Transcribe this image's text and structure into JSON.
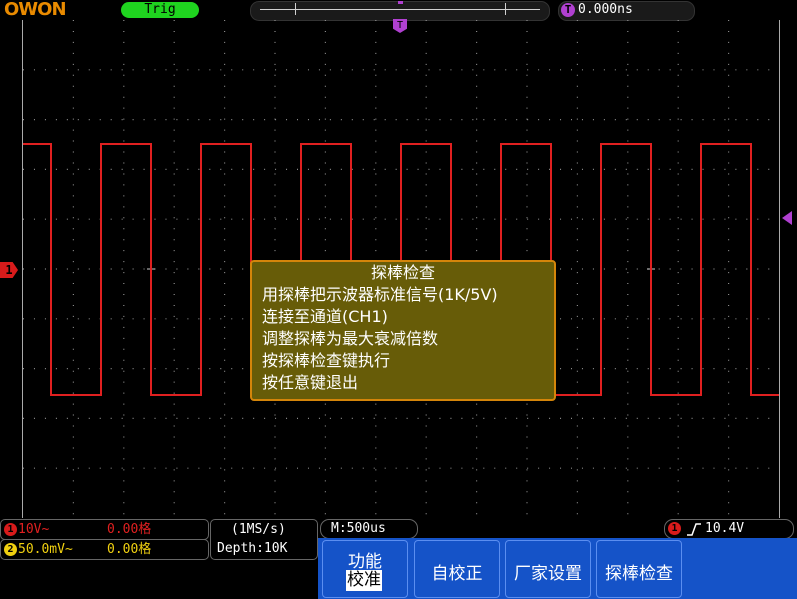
{
  "brand": "OWON",
  "topbar": {
    "status": "Trig",
    "trigger_time_icon": "T",
    "trigger_time": "0.000ns"
  },
  "screen": {
    "trigger_marker": "T",
    "ch1_marker": "1",
    "waveform": {
      "channel": "CH1",
      "type": "square",
      "color": "#e02020"
    }
  },
  "dialog": {
    "title": "探棒检查",
    "lines": [
      "用探棒把示波器标准信号(1K/5V)",
      "连接至通道(CH1)",
      "调整探棒为最大衰减倍数",
      "按探棒检查键执行",
      "按任意键退出"
    ],
    "border_color": "#d4850a"
  },
  "status": {
    "ch1": {
      "num": "1",
      "scale": "10V~",
      "offset": "0.00格",
      "color": "#d81b1b"
    },
    "ch2": {
      "num": "2",
      "scale": "50.0mV~",
      "offset": "0.00格",
      "color": "#f0d010"
    },
    "sample_rate": "(1MS/s)",
    "depth": "Depth:10K",
    "timebase": "M:500us",
    "trigger": {
      "num": "1",
      "icon": "rising-edge-icon",
      "level": "10.4V"
    }
  },
  "menu": {
    "function_label": "功能",
    "function_value": "校准",
    "auto_cal": "自校正",
    "factory": "厂家设置",
    "probe_check": "探棒检查"
  }
}
